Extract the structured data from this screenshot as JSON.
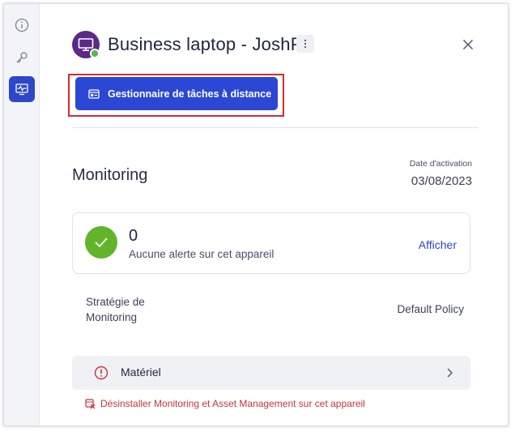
{
  "rail": {
    "items": [
      {
        "icon": "info-icon",
        "active": false
      },
      {
        "icon": "key-icon",
        "active": false
      },
      {
        "icon": "monitoring-icon",
        "active": true
      }
    ]
  },
  "header": {
    "device_name": "Business laptop - JoshP",
    "device_icon": "monitor-icon",
    "status_color": "#58b847"
  },
  "actions": {
    "remote_task_manager_label": "Gestionnaire de tâches à distance"
  },
  "monitoring": {
    "title": "Monitoring",
    "activation_label": "Date d'activation",
    "activation_date": "03/08/2023",
    "alerts": {
      "count": "0",
      "message": "Aucune alerte sur cet appareil",
      "link_label": "Afficher"
    },
    "policy": {
      "label": "Stratégie de Monitoring",
      "value": "Default Policy"
    },
    "hardware": {
      "label": "Matériel"
    },
    "uninstall_label": "Désinstaller Monitoring et Asset Management sur cet appareil"
  },
  "colors": {
    "accent": "#2c47d4",
    "success": "#62b52a",
    "danger": "#c8333a",
    "highlight": "#d42b2b"
  }
}
